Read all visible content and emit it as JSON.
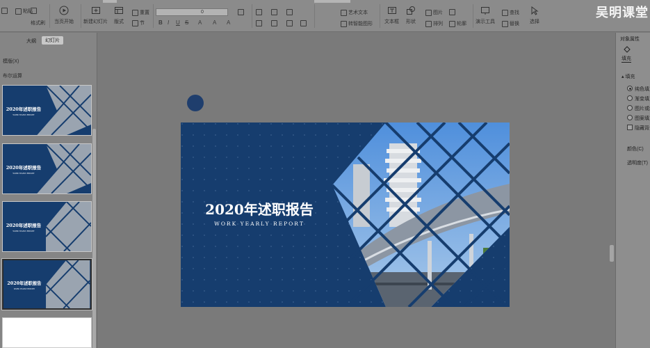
{
  "brand": "吴明课堂",
  "ribbon": {
    "paste": "粘贴",
    "format_painter": "格式刷",
    "play_from_current": "当页开始",
    "new_slide": "新建幻灯片",
    "layout": "版式",
    "section": "节",
    "reset": "重置",
    "font_size": "0",
    "textbox": "文本框",
    "shape": "形状",
    "picture": "图片",
    "arrange": "排列",
    "outline": "轮廓",
    "presentation_tools": "演示工具",
    "find": "查找",
    "replace": "替换",
    "select": "选择",
    "text_effect": "艺术文本",
    "convert_to_smartart": "转智能图形"
  },
  "left_panel": {
    "tabs": [
      "大纲",
      "幻灯片"
    ],
    "active_tab": "幻灯片",
    "template_label": "模版(X)",
    "layout_label": "布尔运算"
  },
  "slide": {
    "title": "2020年述职报告",
    "subtitle": "WORK YEARLY REPORT"
  },
  "right_panel": {
    "title": "对象属性",
    "fill_tab": "填充",
    "section": "填充",
    "options": [
      "纯色填充",
      "渐变填充",
      "图片或纹理填充",
      "图案填充"
    ],
    "selected_option": 0,
    "hide_bg": "隐藏背景图形",
    "color_label": "颜色(C)",
    "transparency_label": "透明度(T)"
  },
  "colors": {
    "slide_bg": "#163d6e",
    "accent_dot": "#1f3e6d",
    "brand_text": "#f4f4f4"
  }
}
